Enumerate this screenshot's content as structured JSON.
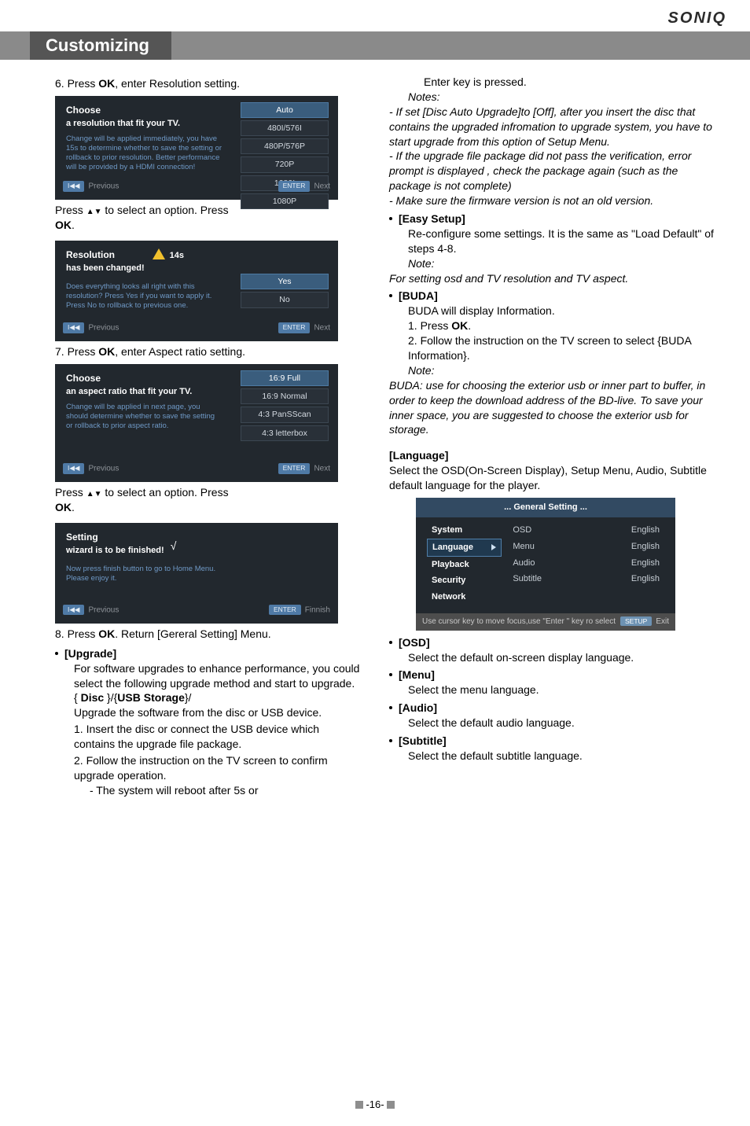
{
  "brand": "SONIQ",
  "title": "Customizing",
  "left": {
    "step6": "6. Press OK, enter Resolution setting.",
    "panel1": {
      "caption": "Choose",
      "subcap": "a resolution that fit your TV.",
      "desc": "Change will be applied immediately, you have 15s to determine whether to save the setting or rollback to prior resolution. Better performance will be provided by a HDMI connection!",
      "opts": [
        "Auto",
        "480I/576I",
        "480P/576P",
        "720P",
        "1080I",
        "1080P"
      ],
      "opt_sel": 0,
      "prev": "Previous",
      "next": "Next",
      "prev_chip": "I◀◀",
      "next_chip": "ENTER"
    },
    "press1a": "Press ",
    "press1b": " to select an option. Press ",
    "press1ok": "OK",
    "press1c": ".",
    "panel2": {
      "caption": "Resolution",
      "subcap": "has been changed!",
      "timer": "14s",
      "desc": "Does everything looks all right with this resolution? Press Yes if you want to apply it. Press No to rollback to previous one.",
      "opts": [
        "Yes",
        "No"
      ],
      "opt_sel": 0,
      "prev": "Previous",
      "next": "Next"
    },
    "step7": "7. Press OK, enter Aspect ratio setting.",
    "panel3": {
      "caption": "Choose",
      "subcap": "an aspect ratio that fit your TV.",
      "desc": "Change will be applied in next page, you should determine whether to save the setting or rollback to prior aspect ratio.",
      "opts": [
        "16:9 Full",
        "16:9 Normal",
        "4:3 PanSScan",
        "4:3 letterbox"
      ],
      "opt_sel": 0,
      "prev": "Previous",
      "next": "Next"
    },
    "press2a": "Press ",
    "press2b": " to select an option. Press ",
    "press2ok": "OK",
    "press2c": ".",
    "panel4": {
      "caption": "Setting",
      "subcap": "wizard is to be finished!",
      "desc": "Now press finish button to go to Home Menu. Please enjoy it.",
      "prev": "Previous",
      "next": "Finnish",
      "next_chip": "ENTER"
    },
    "step8": "8. Press OK. Return [Gereral Setting] Menu.",
    "upgrade_label": "[Upgrade]",
    "upgrade_body1": "For software upgrades to enhance performance, you could select the following upgrade method and start to upgrade.",
    "upgrade_list_label": "{ Disc }/{USB Storage}/",
    "upgrade_body2": "Upgrade the software from the disc or USB device.",
    "upg1": "1. Insert the disc or connect the USB device which contains the upgrade file package.",
    "upg2": "2. Follow the instruction on the TV screen to confirm upgrade operation.",
    "upg2a": "- The system will reboot after 5s or"
  },
  "right": {
    "cont": "Enter key is pressed.",
    "notes_label": "Notes:",
    "note1": "- If set [Disc Auto Upgrade]to [Off], after you insert the disc that contains the upgraded infromation to upgrade system, you have to start upgrade from this option of Setup Menu.",
    "note2": "- If the upgrade file package did not pass the verification, error prompt is displayed , check the package again (such as the package is not complete)",
    "note3": "- Make sure the firmware version is not an old version.",
    "easy_label": "[Easy Setup]",
    "easy_body": "Re-configure some settings. It is the same as \"Load Default\" of steps 4-8.",
    "easy_note_label": "Note:",
    "easy_note_body": "For setting osd and TV resolution and TV aspect.",
    "buda_label": "[BUDA]",
    "buda_body": "BUDA will display Information.",
    "buda1": "1. Press OK.",
    "buda2": "2. Follow the instruction on the TV screen to select {BUDA Information}.",
    "buda_note_label": "Note:",
    "buda_note_body": "BUDA: use for choosing the exterior usb or inner part to buffer, in order to keep the download address of the BD-live. To save your inner space, you are suggested to choose the exterior usb for storage.",
    "lang_head": "[Language]",
    "lang_body": "Select the OSD(On-Screen Display), Setup Menu, Audio, Subtitle default language for the player.",
    "gsmenu": {
      "title": "... General Setting ...",
      "left": [
        "System",
        "Language",
        "Playback",
        "Security",
        "Network"
      ],
      "sel_index": 1,
      "mid": [
        "OSD",
        "Menu",
        "Audio",
        "Subtitle"
      ],
      "right": [
        "English",
        "English",
        "English",
        "English"
      ],
      "foot_left": "Use cursor key to move focus,use \"Enter \" key ro select",
      "foot_chip": "SETUP",
      "foot_right": "Exit"
    },
    "osd_label": "[OSD]",
    "osd_body": "Select the default on-screen display language.",
    "menu_label": "[Menu]",
    "menu_body": "Select the menu language.",
    "audio_label": "[Audio]",
    "audio_body": "Select the default audio language.",
    "subtitle_label": "[Subtitle]",
    "subtitle_body": "Select the default subtitle language."
  },
  "pagefoot": "-16-"
}
